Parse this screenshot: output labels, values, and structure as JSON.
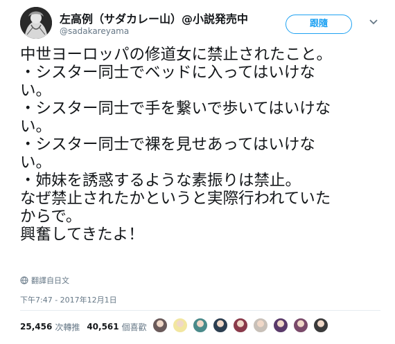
{
  "author": {
    "display_name": "左高例（サダカレー山）@小説発売中",
    "username": "@sadakareyama"
  },
  "follow_button": "跟隨",
  "tweet_lines": [
    "中世ヨーロッパの修道女に禁止されたこと。",
    "・シスター同士でベッドに入ってはいけな",
    "い。",
    "・シスター同士で手を繋いで歩いてはいけな",
    "い。",
    "・シスター同士で裸を見せあってはいけな",
    "い。",
    "・姉妹を誘惑するような素振りは禁止。",
    "なぜ禁止されたかというと実際行われていた",
    "からで。",
    "興奮してきたよ！"
  ],
  "translate_label": "翻譯自日文",
  "timestamp": "下午7:47 - 2017年12月1日",
  "stats": {
    "retweets_count": "25,456",
    "retweets_label": "次轉推",
    "likes_count": "40,561",
    "likes_label": "個喜歡"
  },
  "liker_avatars": [
    {
      "name": "liker-avatar-1",
      "color": "#6a5a5a"
    },
    {
      "name": "liker-avatar-2",
      "color": "#f2e6a0"
    },
    {
      "name": "liker-avatar-3",
      "color": "#4a8a8a"
    },
    {
      "name": "liker-avatar-4",
      "color": "#2c3e50"
    },
    {
      "name": "liker-avatar-5",
      "color": "#8a3a4a"
    },
    {
      "name": "liker-avatar-6",
      "color": "#c8c0b8"
    },
    {
      "name": "liker-avatar-7",
      "color": "#5a3a6a"
    },
    {
      "name": "liker-avatar-8",
      "color": "#7a4a6a"
    },
    {
      "name": "liker-avatar-9",
      "color": "#3a3a3a"
    }
  ],
  "colors": {
    "accent": "#1da1f2",
    "secondary_text": "#657786",
    "primary_text": "#14171a"
  }
}
